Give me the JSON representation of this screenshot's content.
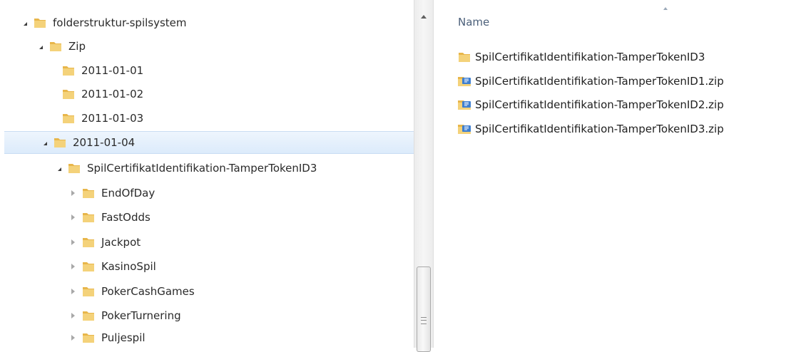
{
  "tree": {
    "rows": [
      {
        "label": "folderstruktur-spilsystem",
        "arrow": "expanded"
      },
      {
        "label": "Zip",
        "arrow": "expanded"
      },
      {
        "label": "2011-01-01",
        "arrow": "none"
      },
      {
        "label": "2011-01-02",
        "arrow": "none"
      },
      {
        "label": "2011-01-03",
        "arrow": "none"
      },
      {
        "label": "2011-01-04",
        "arrow": "expanded",
        "selected": true
      },
      {
        "label": "SpilCertifikatIdentifikation-TamperTokenID3",
        "arrow": "expanded"
      },
      {
        "label": "EndOfDay",
        "arrow": "collapsed"
      },
      {
        "label": "FastOdds",
        "arrow": "collapsed"
      },
      {
        "label": "Jackpot",
        "arrow": "collapsed"
      },
      {
        "label": "KasinoSpil",
        "arrow": "collapsed"
      },
      {
        "label": "PokerCashGames",
        "arrow": "collapsed"
      },
      {
        "label": "PokerTurnering",
        "arrow": "collapsed"
      },
      {
        "label": "Puljespil",
        "arrow": "collapsed"
      }
    ]
  },
  "content": {
    "column_header": "Name",
    "files": [
      {
        "label": "SpilCertifikatIdentifikation-TamperTokenID3",
        "icon": "folder-icon"
      },
      {
        "label": "SpilCertifikatIdentifikation-TamperTokenID1.zip",
        "icon": "zip-folder-icon"
      },
      {
        "label": "SpilCertifikatIdentifikation-TamperTokenID2.zip",
        "icon": "zip-folder-icon"
      },
      {
        "label": "SpilCertifikatIdentifikation-TamperTokenID3.zip",
        "icon": "zip-folder-icon"
      }
    ]
  },
  "colors": {
    "folder": "#e8b64a",
    "selection": "#dcebfb",
    "header_text": "#4c607a"
  }
}
